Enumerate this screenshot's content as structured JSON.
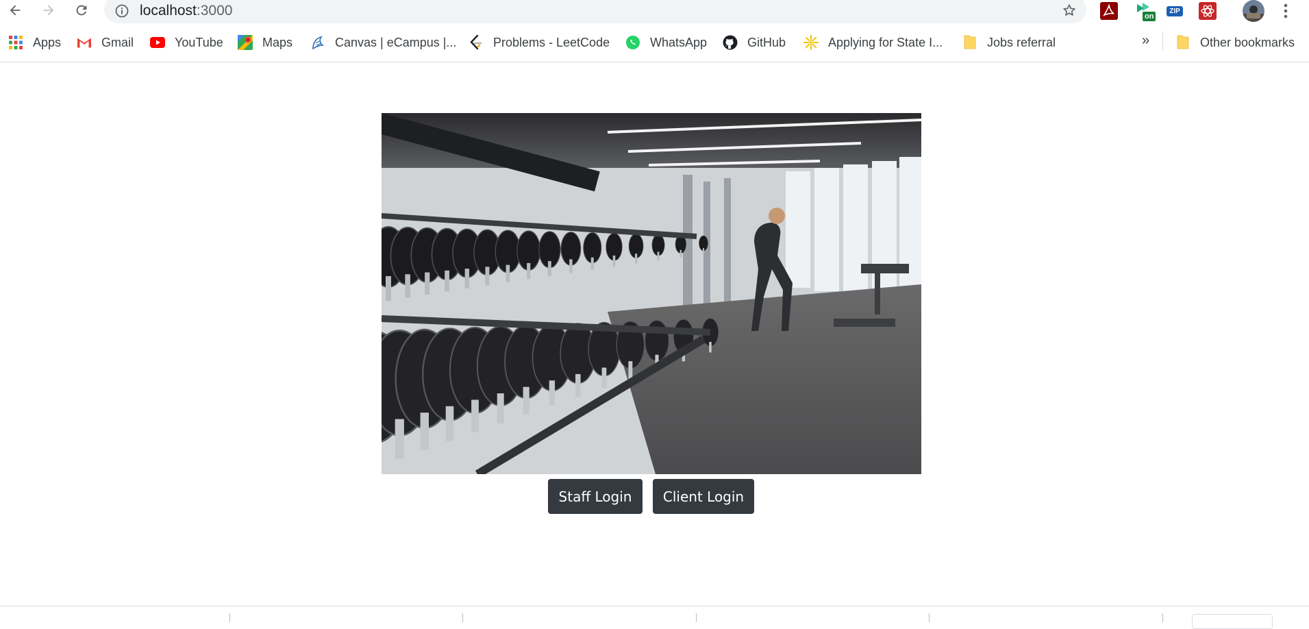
{
  "browser": {
    "url_host": "localhost",
    "url_path": ":3000",
    "bookmarks": [
      {
        "label": "Apps",
        "icon": "apps-grid-icon"
      },
      {
        "label": "Gmail",
        "icon": "gmail-icon"
      },
      {
        "label": "YouTube",
        "icon": "youtube-icon"
      },
      {
        "label": "Maps",
        "icon": "maps-icon"
      },
      {
        "label": "Canvas | eCampus |...",
        "icon": "canvas-icon"
      },
      {
        "label": "Problems - LeetCode",
        "icon": "leetcode-icon"
      },
      {
        "label": "WhatsApp",
        "icon": "whatsapp-icon"
      },
      {
        "label": "GitHub",
        "icon": "github-icon"
      },
      {
        "label": "Applying for State I...",
        "icon": "sun-icon"
      },
      {
        "label": "Jobs referral",
        "icon": "folder-icon"
      }
    ],
    "overflow": "»",
    "other_bookmarks": "Other bookmarks",
    "extension_badges": {
      "on": "on",
      "zip": "ZIP"
    }
  },
  "page": {
    "hero_image": "gym-dumbbell-rack-photo",
    "staff_login": "Staff Login",
    "client_login": "Client Login"
  },
  "colors": {
    "button_bg": "#343a40",
    "button_text": "#ffffff"
  }
}
